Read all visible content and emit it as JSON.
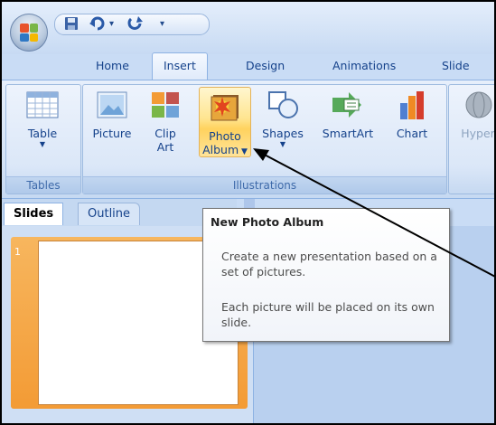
{
  "qat": {
    "save_icon": "save-icon",
    "undo_icon": "undo-icon",
    "undo_dropdown": "▾",
    "redo_icon": "redo-icon",
    "customize": "▾"
  },
  "tabs": [
    {
      "label": "Home"
    },
    {
      "label": "Insert"
    },
    {
      "label": "Design"
    },
    {
      "label": "Animations"
    },
    {
      "label": "Slide Sh"
    }
  ],
  "ribbon": {
    "tables": {
      "label": "Tables",
      "table_button": "Table"
    },
    "illustrations": {
      "label": "Illustrations",
      "picture": "Picture",
      "clip_art_1": "Clip",
      "clip_art_2": "Art",
      "photo_album_1": "Photo",
      "photo_album_2": "Album",
      "shapes": "Shapes",
      "smartart": "SmartArt",
      "chart": "Chart"
    },
    "links": {
      "hyperlink": "Hyper"
    }
  },
  "pane": {
    "tab_slides": "Slides",
    "tab_outline": "Outline",
    "slide_number": "1"
  },
  "tooltip": {
    "title": "New Photo Album",
    "line1": "Create a new presentation based on a set of pictures.",
    "line2": "Each picture will be placed on its own slide."
  },
  "colors": {
    "accent": "#15428b",
    "ribbon_bg": "#d4e3f6",
    "slide_highlight": "#f39b35",
    "hot_button": "#ffd25e"
  }
}
